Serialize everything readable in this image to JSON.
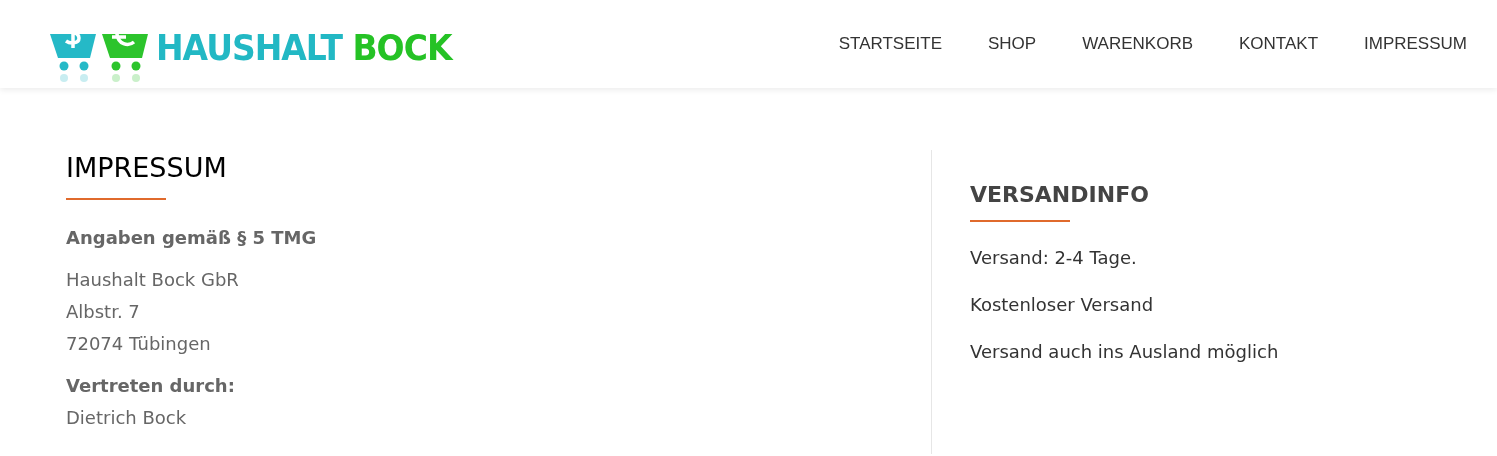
{
  "logo": {
    "word_1": "HAUSHALT",
    "word_2": "BOCK"
  },
  "nav": [
    {
      "label": "STARTSEITE"
    },
    {
      "label": "SHOP"
    },
    {
      "label": "WARENKORB"
    },
    {
      "label": "KONTAKT"
    },
    {
      "label": "IMPRESSUM"
    }
  ],
  "main": {
    "title": "IMPRESSUM",
    "blocks": [
      {
        "heading": "Angaben gemäß § 5 TMG"
      },
      {
        "lines": [
          "Haushalt Bock GbR",
          "Albstr. 7",
          "72074 Tübingen"
        ]
      },
      {
        "heading": "Vertreten durch:",
        "lines": [
          "Dietrich Bock"
        ]
      }
    ]
  },
  "sidebar": {
    "title": "VERSANDINFO",
    "lines": [
      "Versand: 2-4 Tage.",
      "Kostenloser Versand",
      "Versand auch ins Ausland möglich"
    ]
  }
}
